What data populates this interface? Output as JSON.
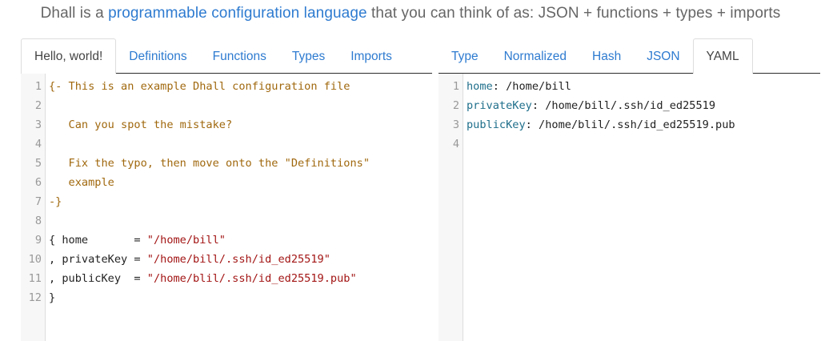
{
  "tagline": {
    "before": "Dhall is a ",
    "link": "programmable configuration language",
    "after": " that you can think of as: JSON + functions + types + imports"
  },
  "left_pane": {
    "tabs": [
      {
        "label": "Hello, world!",
        "active": true
      },
      {
        "label": "Definitions",
        "active": false
      },
      {
        "label": "Functions",
        "active": false
      },
      {
        "label": "Types",
        "active": false
      },
      {
        "label": "Imports",
        "active": false
      }
    ],
    "lines": [
      {
        "n": "1",
        "text": "{- This is an example Dhall configuration file",
        "kind": "comment"
      },
      {
        "n": "2",
        "text": "",
        "kind": "comment"
      },
      {
        "n": "3",
        "text": "   Can you spot the mistake?",
        "kind": "comment"
      },
      {
        "n": "4",
        "text": "",
        "kind": "comment"
      },
      {
        "n": "5",
        "text": "   Fix the typo, then move onto the \"Definitions\"",
        "kind": "comment"
      },
      {
        "n": "6",
        "text": "   example",
        "kind": "comment"
      },
      {
        "n": "7",
        "text": "-}",
        "kind": "comment"
      },
      {
        "n": "8",
        "text": "",
        "kind": "plain"
      },
      {
        "n": "9",
        "pre": "{ home       = ",
        "str": "\"/home/bill\"",
        "kind": "field"
      },
      {
        "n": "10",
        "pre": ", privateKey = ",
        "str": "\"/home/bill/.ssh/id_ed25519\"",
        "kind": "field"
      },
      {
        "n": "11",
        "pre": ", publicKey  = ",
        "str": "\"/home/blil/.ssh/id_ed25519.pub\"",
        "kind": "field"
      },
      {
        "n": "12",
        "text": "}",
        "kind": "plain"
      }
    ]
  },
  "right_pane": {
    "tabs": [
      {
        "label": "Type",
        "active": false
      },
      {
        "label": "Normalized",
        "active": false
      },
      {
        "label": "Hash",
        "active": false
      },
      {
        "label": "JSON",
        "active": false
      },
      {
        "label": "YAML",
        "active": true
      }
    ],
    "lines": [
      {
        "n": "1",
        "key": "home",
        "val": " /home/bill"
      },
      {
        "n": "2",
        "key": "privateKey",
        "val": " /home/bill/.ssh/id_ed25519"
      },
      {
        "n": "3",
        "key": "publicKey",
        "val": " /home/blil/.ssh/id_ed25519.pub"
      },
      {
        "n": "4",
        "key": "",
        "val": ""
      }
    ]
  }
}
